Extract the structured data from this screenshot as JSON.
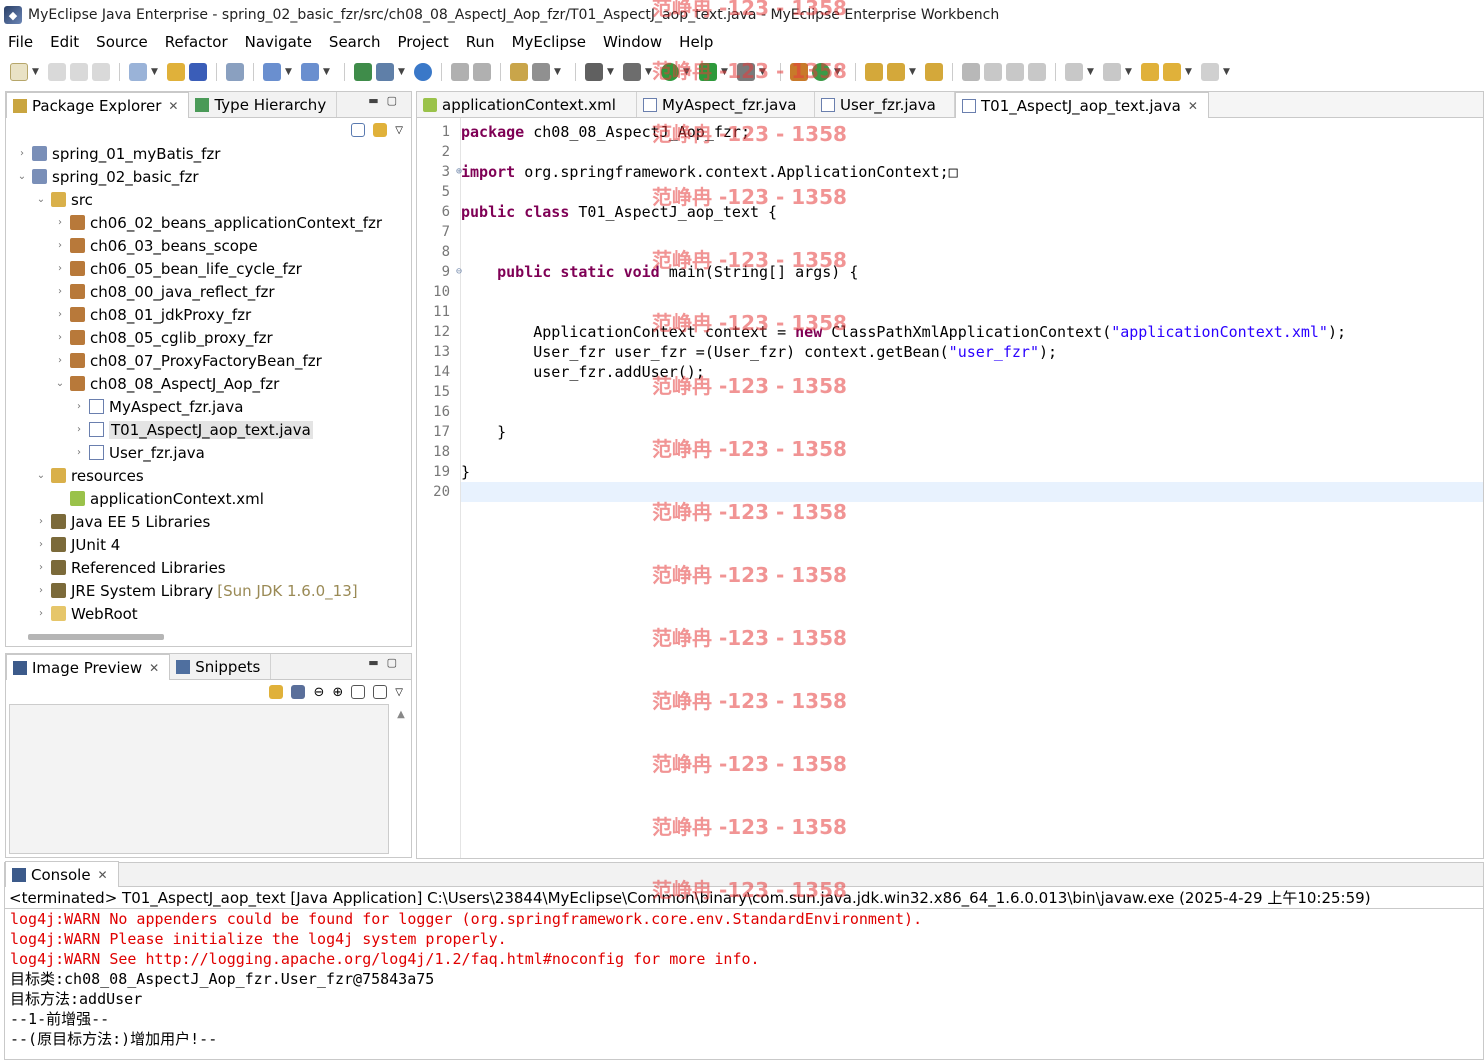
{
  "window": {
    "title": "MyEclipse Java Enterprise - spring_02_basic_fzr/src/ch08_08_AspectJ_Aop_fzr/T01_AspectJ_aop_text.java - MyEclipse Enterprise Workbench"
  },
  "menu": [
    "File",
    "Edit",
    "Source",
    "Refactor",
    "Navigate",
    "Search",
    "Project",
    "Run",
    "MyEclipse",
    "Window",
    "Help"
  ],
  "package_explorer": {
    "tabs": [
      "Package Explorer",
      "Type Hierarchy"
    ],
    "tree": [
      {
        "label": "spring_01_myBatis_fzr",
        "level": 0,
        "twisty": "collapsed",
        "icon": "project-icon"
      },
      {
        "label": "spring_02_basic_fzr",
        "level": 0,
        "twisty": "expanded",
        "icon": "project-icon"
      },
      {
        "label": "src",
        "level": 1,
        "twisty": "expanded",
        "icon": "source-folder-icon"
      },
      {
        "label": "ch06_02_beans_applicationContext_fzr",
        "level": 2,
        "twisty": "collapsed",
        "icon": "package-icon"
      },
      {
        "label": "ch06_03_beans_scope",
        "level": 2,
        "twisty": "collapsed",
        "icon": "package-icon"
      },
      {
        "label": "ch06_05_bean_life_cycle_fzr",
        "level": 2,
        "twisty": "collapsed",
        "icon": "package-icon"
      },
      {
        "label": "ch08_00_java_reflect_fzr",
        "level": 2,
        "twisty": "collapsed",
        "icon": "package-icon"
      },
      {
        "label": "ch08_01_jdkProxy_fzr",
        "level": 2,
        "twisty": "collapsed",
        "icon": "package-icon"
      },
      {
        "label": "ch08_05_cglib_proxy_fzr",
        "level": 2,
        "twisty": "collapsed",
        "icon": "package-icon"
      },
      {
        "label": "ch08_07_ProxyFactoryBean_fzr",
        "level": 2,
        "twisty": "collapsed",
        "icon": "package-icon"
      },
      {
        "label": "ch08_08_AspectJ_Aop_fzr",
        "level": 2,
        "twisty": "expanded",
        "icon": "package-icon"
      },
      {
        "label": "MyAspect_fzr.java",
        "level": 3,
        "twisty": "collapsed",
        "icon": "java-file-icon"
      },
      {
        "label": "T01_AspectJ_aop_text.java",
        "level": 3,
        "twisty": "collapsed",
        "icon": "java-file-icon",
        "selected": true
      },
      {
        "label": "User_fzr.java",
        "level": 3,
        "twisty": "collapsed",
        "icon": "java-file-icon"
      },
      {
        "label": "resources",
        "level": 1,
        "twisty": "expanded",
        "icon": "source-folder-icon"
      },
      {
        "label": "applicationContext.xml",
        "level": 2,
        "twisty": "none",
        "icon": "xml-file-icon"
      },
      {
        "label": "Java EE 5 Libraries",
        "level": 1,
        "twisty": "collapsed",
        "icon": "library-icon"
      },
      {
        "label": "JUnit 4",
        "level": 1,
        "twisty": "collapsed",
        "icon": "library-icon"
      },
      {
        "label": "Referenced Libraries",
        "level": 1,
        "twisty": "collapsed",
        "icon": "library-icon"
      },
      {
        "label": "JRE System Library",
        "decoration": "[Sun JDK 1.6.0_13]",
        "level": 1,
        "twisty": "collapsed",
        "icon": "library-icon"
      },
      {
        "label": "WebRoot",
        "level": 1,
        "twisty": "collapsed",
        "icon": "folder-icon"
      }
    ]
  },
  "image_preview": {
    "tabs": [
      "Image Preview",
      "Snippets"
    ]
  },
  "editor": {
    "tabs": [
      {
        "label": "applicationContext.xml",
        "icon": "xml-file-icon",
        "active": false
      },
      {
        "label": "MyAspect_fzr.java",
        "icon": "java-file-icon",
        "active": false
      },
      {
        "label": "User_fzr.java",
        "icon": "java-file-icon",
        "active": false
      },
      {
        "label": "T01_AspectJ_aop_text.java",
        "icon": "java-file-icon",
        "active": true
      }
    ],
    "lines": [
      {
        "no": "1",
        "html": "<span class=\"kw\">package</span> ch08_08_AspectJ_Aop_fzr;"
      },
      {
        "no": "2",
        "html": ""
      },
      {
        "no": "3",
        "fold": "plus",
        "html": "<span class=\"kw\">import</span> org.springframework.context.ApplicationContext;□"
      },
      {
        "no": "5",
        "html": ""
      },
      {
        "no": "6",
        "html": "<span class=\"kw\">public</span> <span class=\"kw\">class</span> T01_AspectJ_aop_text {"
      },
      {
        "no": "7",
        "html": ""
      },
      {
        "no": "8",
        "html": ""
      },
      {
        "no": "9",
        "fold": "minus",
        "html": "    <span class=\"kw\">public</span> <span class=\"kw\">static</span> <span class=\"kw\">void</span> main(String[] args) {"
      },
      {
        "no": "10",
        "html": ""
      },
      {
        "no": "11",
        "html": ""
      },
      {
        "no": "12",
        "html": "        ApplicationContext context = <span class=\"kw\">new</span> ClassPathXmlApplicationContext(<span class=\"str\">\"applicationContext.xml\"</span>);"
      },
      {
        "no": "13",
        "html": "        User_fzr user_fzr =(User_fzr) context.getBean(<span class=\"str\">\"user_fzr\"</span>);"
      },
      {
        "no": "14",
        "html": "        user_fzr.addUser();"
      },
      {
        "no": "15",
        "html": ""
      },
      {
        "no": "16",
        "html": ""
      },
      {
        "no": "17",
        "html": "    }"
      },
      {
        "no": "18",
        "html": ""
      },
      {
        "no": "19",
        "html": "}"
      },
      {
        "no": "20",
        "html": "",
        "current": true
      }
    ]
  },
  "console": {
    "tab": "Console",
    "header": "<terminated> T01_AspectJ_aop_text [Java Application] C:\\Users\\23844\\MyEclipse\\Common\\binary\\com.sun.java.jdk.win32.x86_64_1.6.0.013\\bin\\javaw.exe (2025-4-29 上午10:25:59)",
    "lines": [
      {
        "text": "log4j:WARN No appenders could be found for logger (org.springframework.core.env.StandardEnvironment).",
        "type": "err"
      },
      {
        "text": "log4j:WARN Please initialize the log4j system properly.",
        "type": "err"
      },
      {
        "text": "log4j:WARN See http://logging.apache.org/log4j/1.2/faq.html#noconfig for more info.",
        "type": "err"
      },
      {
        "text": "目标类:ch08_08_AspectJ_Aop_fzr.User_fzr@75843a75",
        "type": "out"
      },
      {
        "text": "目标方法:addUser",
        "type": "out"
      },
      {
        "text": "--1-前增强--",
        "type": "out"
      },
      {
        "text": "--(原目标方法:)增加用户!--",
        "type": "out"
      }
    ]
  },
  "watermark": {
    "text": "范峥冉 -123 - 1358",
    "count": 15
  },
  "colors": {
    "keyword": "#7f0055",
    "string": "#2a00ff",
    "console_error": "#e00000",
    "current_line": "#e8f2fe"
  }
}
